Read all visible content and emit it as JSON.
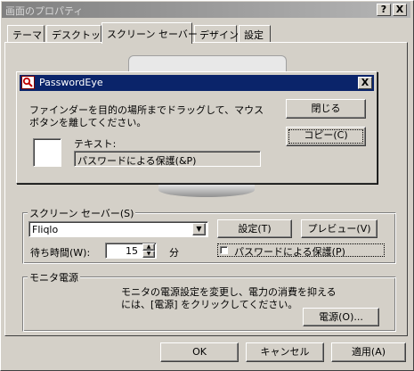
{
  "window": {
    "title": "画面のプロパティ",
    "help_button": "?",
    "close_button": "X"
  },
  "tabs": [
    {
      "label": "テーマ"
    },
    {
      "label": "デスクトップ"
    },
    {
      "label": "スクリーン セーバー",
      "active": true
    },
    {
      "label": "デザイン"
    },
    {
      "label": "設定"
    }
  ],
  "screensaver": {
    "group_label": "スクリーン セーバー(S)",
    "selected": "Fliqlo",
    "settings_button": "設定(T)",
    "preview_button": "プレビュー(V)",
    "wait_label": "待ち時間(W):",
    "wait_value": "15",
    "wait_unit": "分",
    "password_checkbox_label": "パスワードによる保護(P)",
    "password_checked": false
  },
  "power": {
    "group_label": "モニタ電源",
    "description_line1": "モニタの電源設定を変更し、電力の消費を抑える",
    "description_line2": "には、[電源] をクリックしてください。",
    "power_button": "電源(O)..."
  },
  "footer": {
    "ok": "OK",
    "cancel": "キャンセル",
    "apply": "適用(A)"
  },
  "popup": {
    "title": "PasswordEye",
    "close_glyph": "X",
    "instruction_line1": "ファインダーを目的の場所までドラッグして、マウス",
    "instruction_line2": "ボタンを離してください。",
    "text_label": "テキスト:",
    "text_value": "パスワードによる保護(&P)",
    "close_button": "閉じる",
    "copy_button": "コピー(C)"
  }
}
